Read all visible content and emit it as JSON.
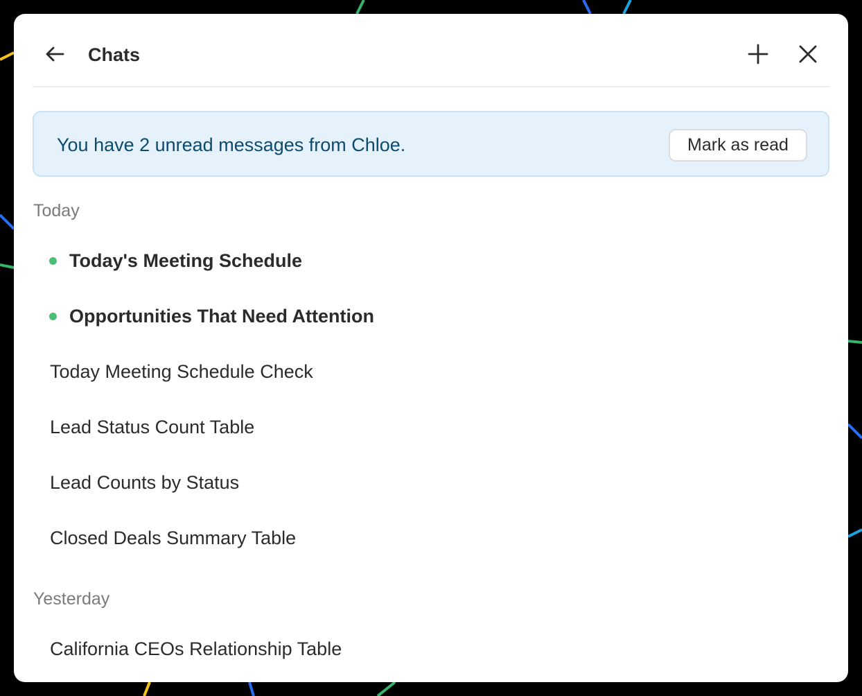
{
  "header": {
    "title": "Chats",
    "back_icon": "arrow-left-icon",
    "add_icon": "plus-icon",
    "close_icon": "close-icon"
  },
  "banner": {
    "message": "You have 2 unread messages from Chloe.",
    "action_label": "Mark as read"
  },
  "sections": [
    {
      "label": "Today",
      "items": [
        {
          "label": "Today's Meeting Schedule",
          "unread": true
        },
        {
          "label": "Opportunities That Need Attention",
          "unread": true
        },
        {
          "label": "Today Meeting Schedule Check",
          "unread": false
        },
        {
          "label": "Lead Status Count Table",
          "unread": false
        },
        {
          "label": "Lead Counts by Status",
          "unread": false
        },
        {
          "label": "Closed Deals Summary Table",
          "unread": false
        }
      ]
    },
    {
      "label": "Yesterday",
      "items": [
        {
          "label": "California CEOs Relationship Table",
          "unread": false
        }
      ]
    }
  ],
  "colors": {
    "unread_dot": "#4cc072",
    "banner_bg": "#e5f2fc",
    "banner_text": "#0c4a6e"
  }
}
